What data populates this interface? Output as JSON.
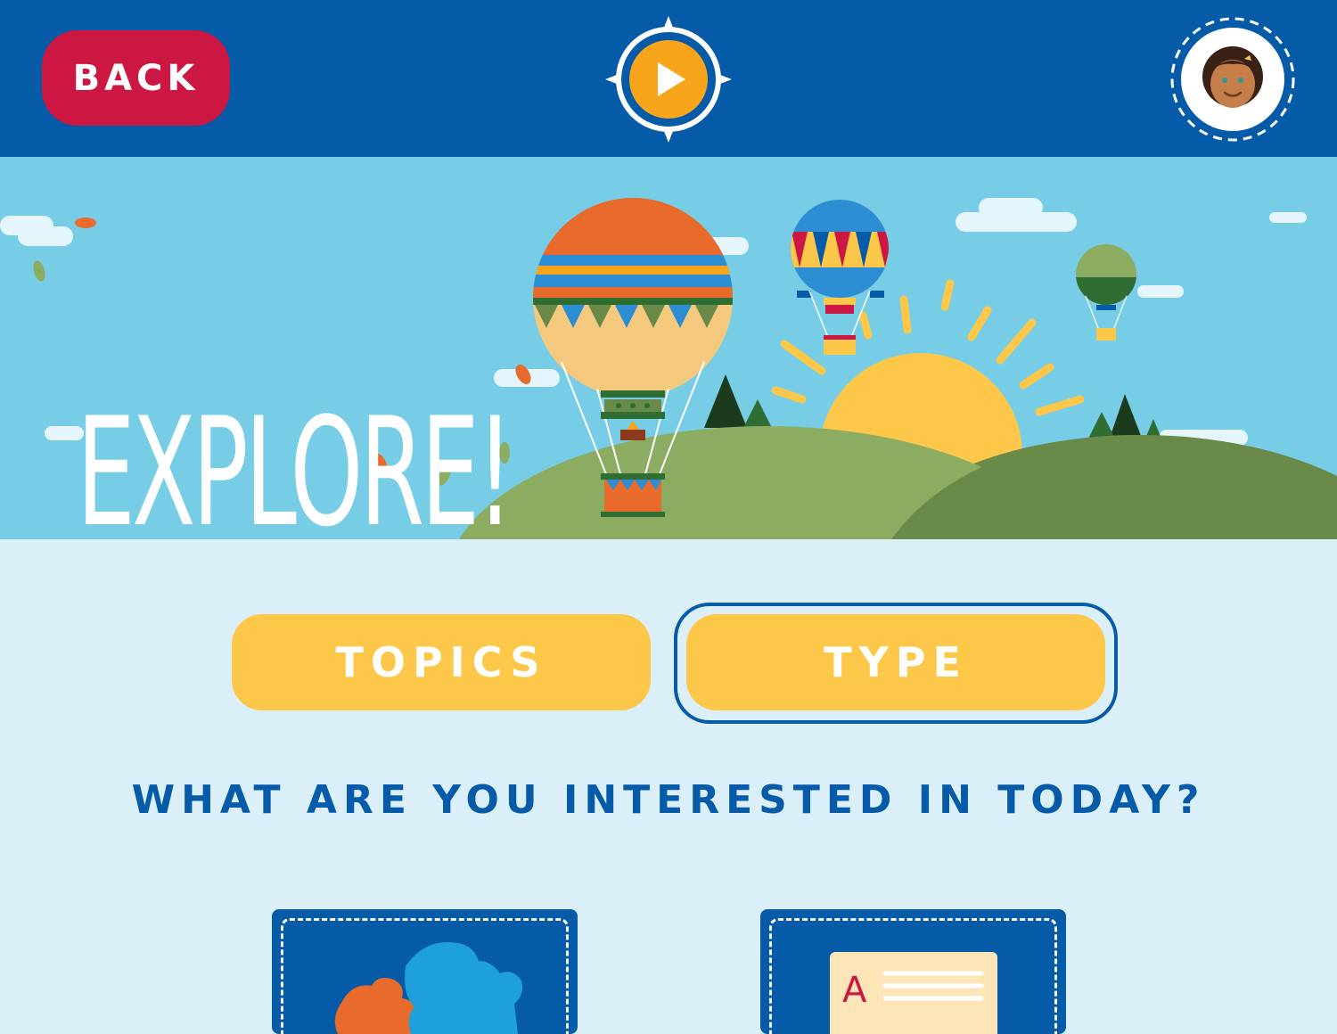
{
  "header": {
    "back_label": "BACK",
    "play_icon": "play-compass-icon",
    "avatar_icon": "child-avatar-icon"
  },
  "banner": {
    "title": "EXPLORE!"
  },
  "tabs": [
    {
      "label": "TOPICS",
      "selected": false
    },
    {
      "label": "TYPE",
      "selected": true
    }
  ],
  "question": "WHAT ARE YOU INTERESTED IN TODAY?",
  "cards": [
    {
      "icon": "puzzle-icon"
    },
    {
      "icon": "document-letter-icon",
      "letter": "A"
    }
  ],
  "colors": {
    "header_bg": "#065ba8",
    "back_button": "#cb1742",
    "tab_yellow": "#fdc74a",
    "page_bg": "#dbeff9",
    "sky": "#77cde5"
  }
}
